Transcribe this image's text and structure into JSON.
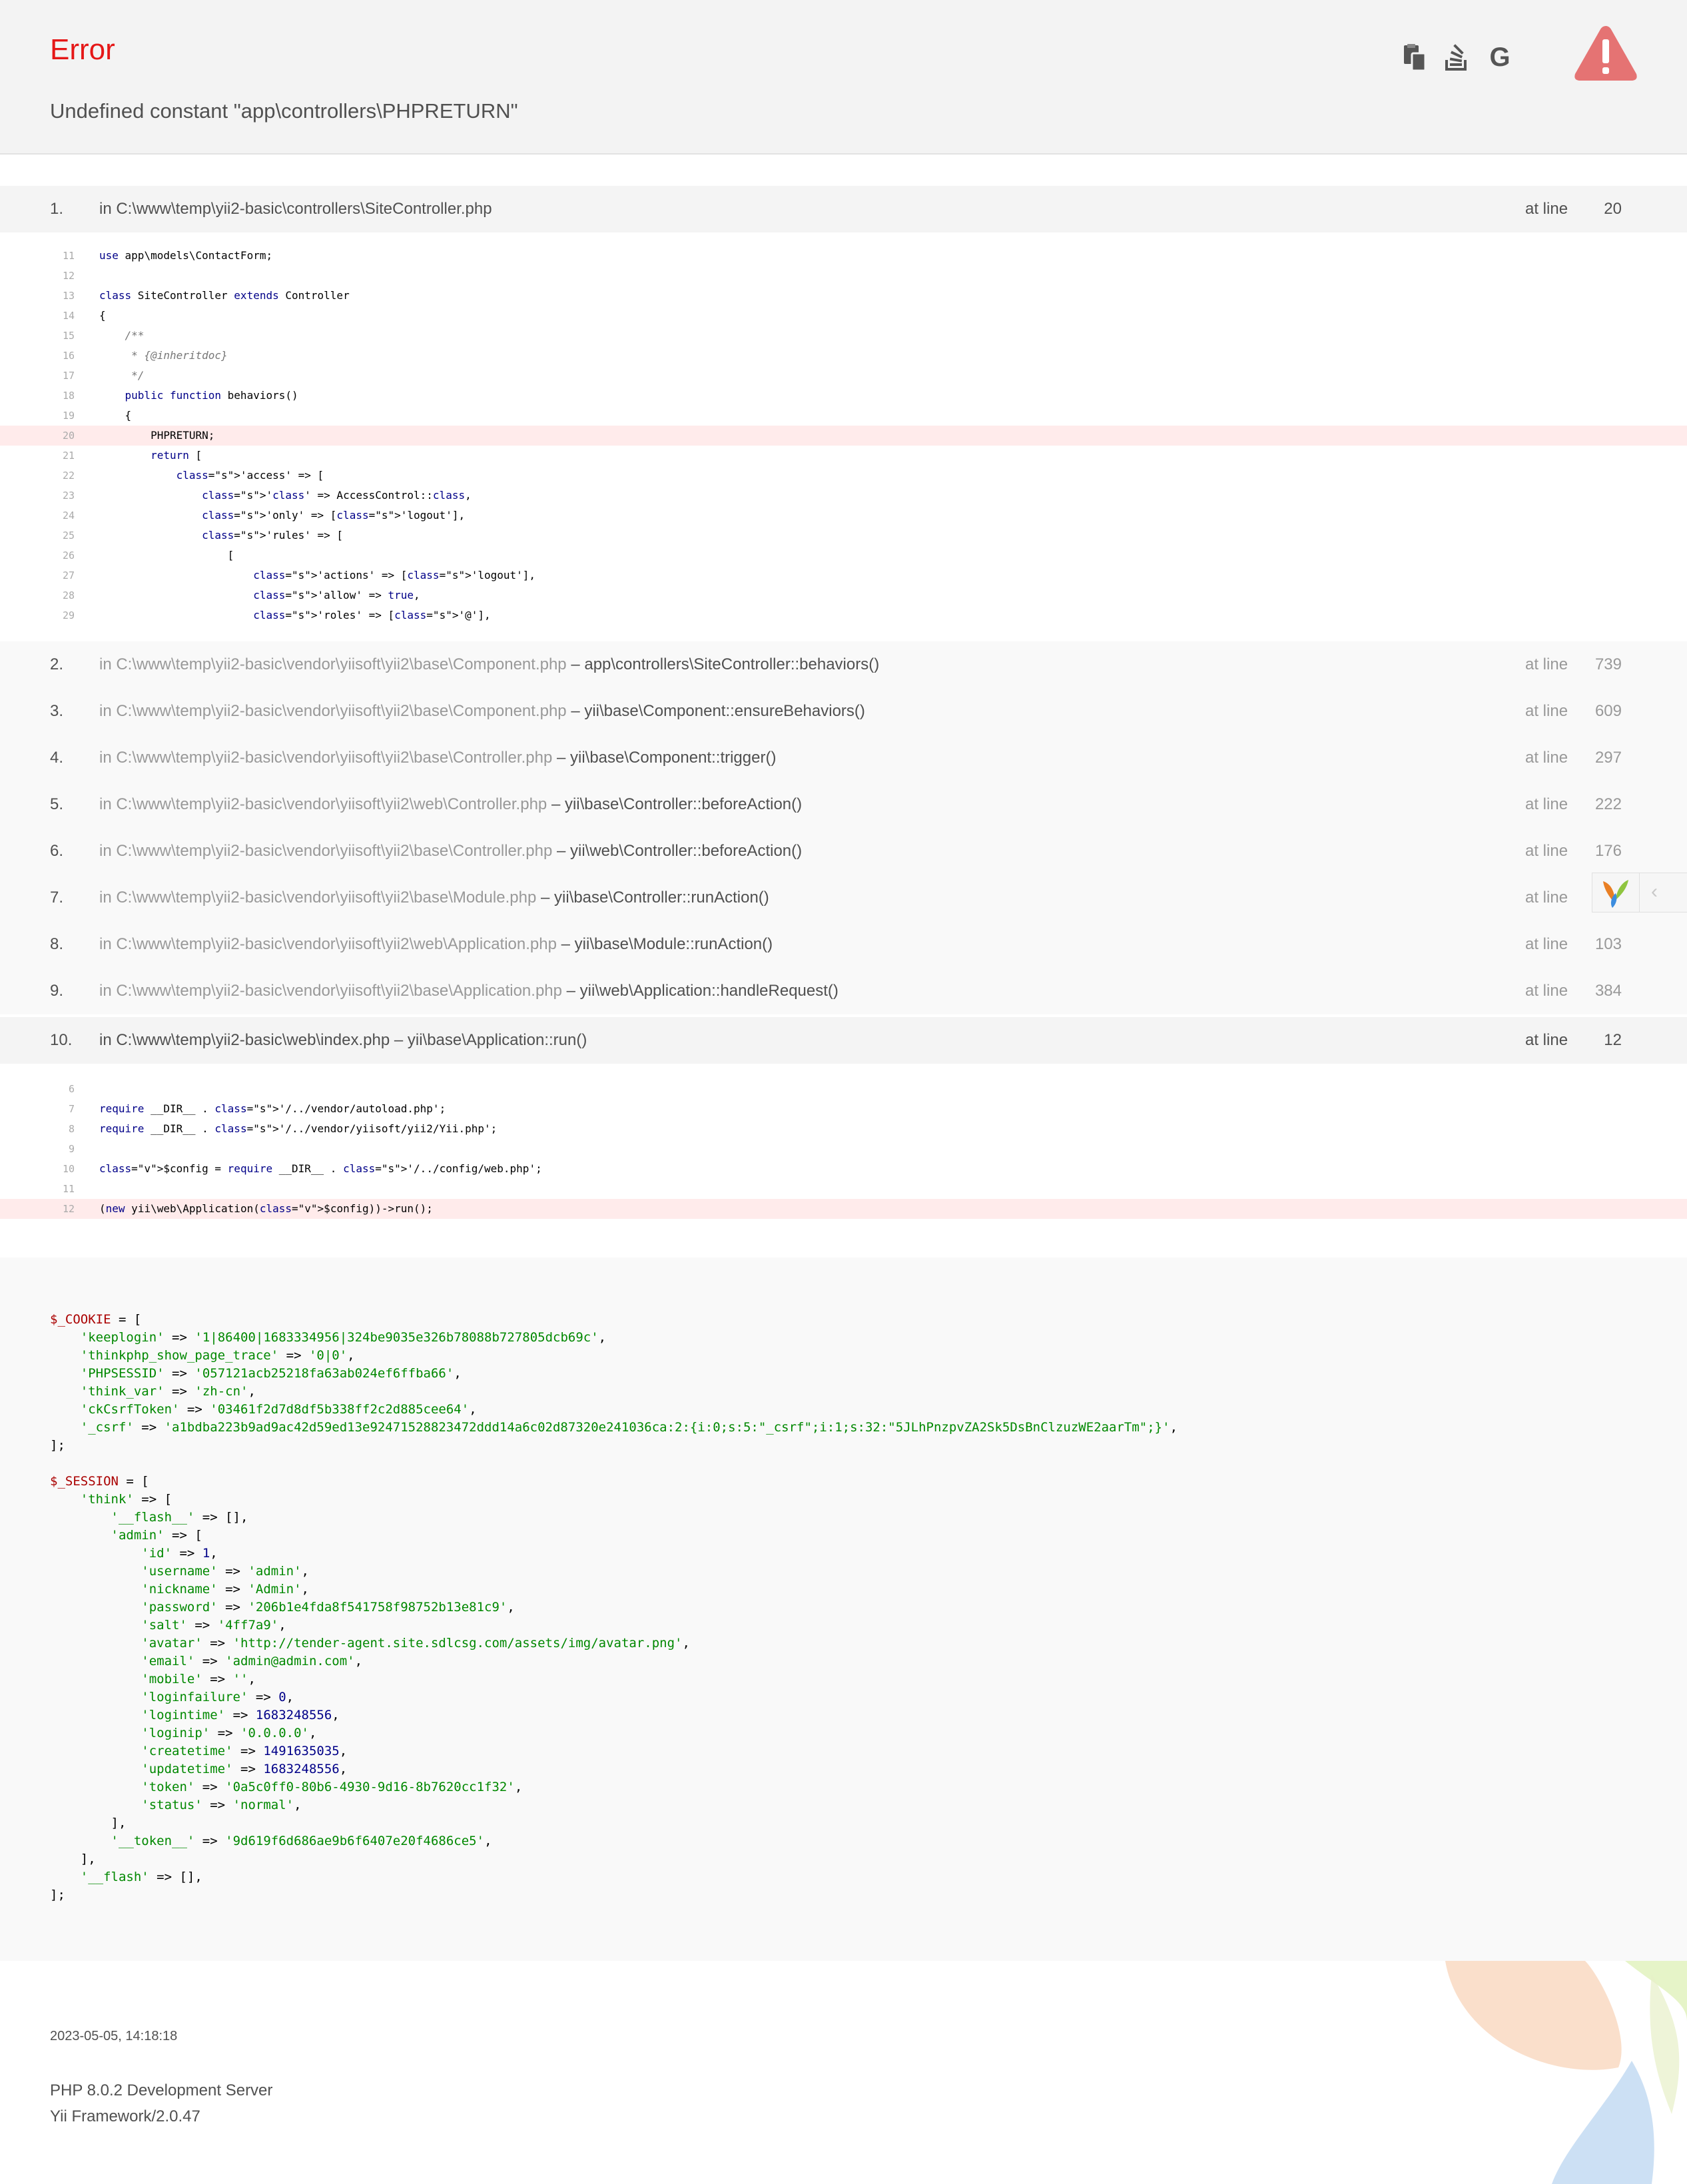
{
  "error": {
    "title": "Error",
    "message": "Undefined constant \"app\\controllers\\PHPRETURN\""
  },
  "toolbar": {
    "copy_icon": "copy-icon",
    "stackoverflow_icon": "stackoverflow-icon",
    "google_icon": "google-icon",
    "warning_icon": "warning-triangle-icon"
  },
  "trace": [
    {
      "num": "1.",
      "file": "in C:\\www\\temp\\yii2-basic\\controllers\\SiteController.php",
      "fn": "",
      "atline": "at line",
      "line": "20",
      "app": true
    },
    {
      "num": "2.",
      "file": "in C:\\www\\temp\\yii2-basic\\vendor\\yiisoft\\yii2\\base\\Component.php",
      "fn": " – app\\controllers\\SiteController::behaviors()",
      "atline": "at line",
      "line": "739",
      "app": false
    },
    {
      "num": "3.",
      "file": "in C:\\www\\temp\\yii2-basic\\vendor\\yiisoft\\yii2\\base\\Component.php",
      "fn": " – yii\\base\\Component::ensureBehaviors()",
      "atline": "at line",
      "line": "609",
      "app": false
    },
    {
      "num": "4.",
      "file": "in C:\\www\\temp\\yii2-basic\\vendor\\yiisoft\\yii2\\base\\Controller.php",
      "fn": " – yii\\base\\Component::trigger()",
      "atline": "at line",
      "line": "297",
      "app": false
    },
    {
      "num": "5.",
      "file": "in C:\\www\\temp\\yii2-basic\\vendor\\yiisoft\\yii2\\web\\Controller.php",
      "fn": " – yii\\base\\Controller::beforeAction()",
      "atline": "at line",
      "line": "222",
      "app": false
    },
    {
      "num": "6.",
      "file": "in C:\\www\\temp\\yii2-basic\\vendor\\yiisoft\\yii2\\base\\Controller.php",
      "fn": " – yii\\web\\Controller::beforeAction()",
      "atline": "at line",
      "line": "176",
      "app": false
    },
    {
      "num": "7.",
      "file": "in C:\\www\\temp\\yii2-basic\\vendor\\yiisoft\\yii2\\base\\Module.php",
      "fn": " – yii\\base\\Controller::runAction()",
      "atline": "at line",
      "line": "",
      "app": false
    },
    {
      "num": "8.",
      "file": "in C:\\www\\temp\\yii2-basic\\vendor\\yiisoft\\yii2\\web\\Application.php",
      "fn": " – yii\\base\\Module::runAction()",
      "atline": "at line",
      "line": "103",
      "app": false
    },
    {
      "num": "9.",
      "file": "in C:\\www\\temp\\yii2-basic\\vendor\\yiisoft\\yii2\\base\\Application.php",
      "fn": " – yii\\web\\Application::handleRequest()",
      "atline": "at line",
      "line": "384",
      "app": false
    },
    {
      "num": "10.",
      "file": "in C:\\www\\temp\\yii2-basic\\web\\index.php",
      "fn": " – yii\\base\\Application::run()",
      "atline": "at line",
      "line": "12",
      "app": true
    }
  ],
  "code1": [
    {
      "n": "11",
      "t": "use app\\models\\ContactForm;"
    },
    {
      "n": "12",
      "t": ""
    },
    {
      "n": "13",
      "t": "class SiteController extends Controller"
    },
    {
      "n": "14",
      "t": "{"
    },
    {
      "n": "15",
      "t": "    /**"
    },
    {
      "n": "16",
      "t": "     * {@inheritdoc}"
    },
    {
      "n": "17",
      "t": "     */"
    },
    {
      "n": "18",
      "t": "    public function behaviors()"
    },
    {
      "n": "19",
      "t": "    {"
    },
    {
      "n": "20",
      "t": "        PHPRETURN;",
      "hl": true
    },
    {
      "n": "21",
      "t": "        return ["
    },
    {
      "n": "22",
      "t": "            'access' => ["
    },
    {
      "n": "23",
      "t": "                'class' => AccessControl::class,"
    },
    {
      "n": "24",
      "t": "                'only' => ['logout'],"
    },
    {
      "n": "25",
      "t": "                'rules' => ["
    },
    {
      "n": "26",
      "t": "                    ["
    },
    {
      "n": "27",
      "t": "                        'actions' => ['logout'],"
    },
    {
      "n": "28",
      "t": "                        'allow' => true,"
    },
    {
      "n": "29",
      "t": "                        'roles' => ['@'],"
    }
  ],
  "code2": [
    {
      "n": "6",
      "t": ""
    },
    {
      "n": "7",
      "t": "require __DIR__ . '/../vendor/autoload.php';"
    },
    {
      "n": "8",
      "t": "require __DIR__ . '/../vendor/yiisoft/yii2/Yii.php';"
    },
    {
      "n": "9",
      "t": ""
    },
    {
      "n": "10",
      "t": "$config = require __DIR__ . '/../config/web.php';"
    },
    {
      "n": "11",
      "t": ""
    },
    {
      "n": "12",
      "t": "(new yii\\web\\Application($config))->run();",
      "hl": true
    }
  ],
  "cookie": {
    "name": "$_COOKIE",
    "items": [
      [
        "keeplogin",
        "1|86400|1683334956|324be9035e326b78088b727805dcb69c"
      ],
      [
        "thinkphp_show_page_trace",
        "0|0"
      ],
      [
        "PHPSESSID",
        "057121acb25218fa63ab024ef6ffba66"
      ],
      [
        "think_var",
        "zh-cn"
      ],
      [
        "ckCsrfToken",
        "03461f2d7d8df5b338ff2c2d885cee64"
      ],
      [
        "_csrf",
        "a1bdba223b9ad9ac42d59ed13e92471528823472ddd14a6c02d87320e241036ca:2:{i:0;s:5:\"_csrf\";i:1;s:32:\"5JLhPnzpvZA2Sk5DsBnClzuzWE2aarTm\";}"
      ]
    ]
  },
  "session": {
    "name": "$_SESSION",
    "think_key": "think",
    "flash_key": "__flash__",
    "admin_key": "admin",
    "admin": [
      [
        "id",
        "1",
        "n"
      ],
      [
        "username",
        "admin",
        "s"
      ],
      [
        "nickname",
        "Admin",
        "s"
      ],
      [
        "password",
        "206b1e4fda8f541758f98752b13e81c9",
        "s"
      ],
      [
        "salt",
        "4ff7a9",
        "s"
      ],
      [
        "avatar",
        "http://tender-agent.site.sdlcsg.com/assets/img/avatar.png",
        "s"
      ],
      [
        "email",
        "admin@admin.com",
        "s"
      ],
      [
        "mobile",
        "",
        "s"
      ],
      [
        "loginfailure",
        "0",
        "n"
      ],
      [
        "logintime",
        "1683248556",
        "n"
      ],
      [
        "loginip",
        "0.0.0.0",
        "s"
      ],
      [
        "createtime",
        "1491635035",
        "n"
      ],
      [
        "updatetime",
        "1683248556",
        "n"
      ],
      [
        "token",
        "0a5c0ff0-80b6-4930-9d16-8b7620cc1f32",
        "s"
      ],
      [
        "status",
        "normal",
        "s"
      ]
    ],
    "token_key": "__token__",
    "token_value": "9d619f6d686ae9b6f6407e20f4686ce5",
    "outer_flash_key": "__flash"
  },
  "footer": {
    "timestamp": "2023-05-05, 14:18:18",
    "server": "PHP 8.0.2 Development Server",
    "framework": "Yii Framework/2.0.47"
  },
  "debug_toolbar": {
    "logo_icon": "yii-logo-icon",
    "toggle_icon": "chevron-left-icon"
  }
}
